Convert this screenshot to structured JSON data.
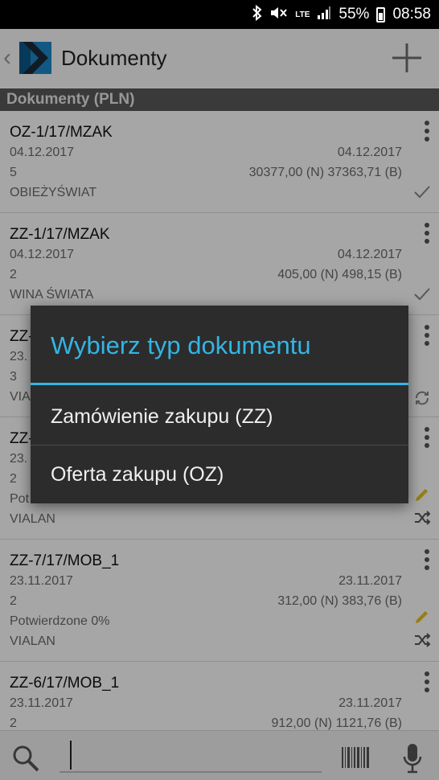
{
  "status_bar": {
    "battery": "55%",
    "time": "08:58",
    "network": "LTE"
  },
  "header": {
    "back": "‹",
    "title": "Dokumenty"
  },
  "section_title": "Dokumenty (PLN)",
  "documents": [
    {
      "number": "OZ-1/17/MZAK",
      "date": "04.12.2017",
      "date2": "04.12.2017",
      "count": "5",
      "amounts": "30377,00 (N) 37363,71 (B)",
      "line3": "OBIEŻYŚWIAT",
      "line4": "",
      "status": "check"
    },
    {
      "number": "ZZ-1/17/MZAK",
      "date": "04.12.2017",
      "date2": "04.12.2017",
      "count": "2",
      "amounts": "405,00 (N) 498,15 (B)",
      "line3": "WINA ŚWIATA",
      "line4": "",
      "status": "check"
    },
    {
      "number": "ZZ-",
      "date": "23.",
      "date2": "",
      "count": "3",
      "amounts": "",
      "line3": "VIAL",
      "line4": "",
      "status": "sync"
    },
    {
      "number": "ZZ-",
      "date": "23.",
      "date2": "",
      "count": "2",
      "amounts": "",
      "line3": "Pot",
      "line4": "VIALAN",
      "status": "edit-shuffle"
    },
    {
      "number": "ZZ-7/17/MOB_1",
      "date": "23.11.2017",
      "date2": "23.11.2017",
      "count": "2",
      "amounts": "312,00 (N) 383,76 (B)",
      "line3": "Potwierdzone 0%",
      "line4": "VIALAN",
      "status": "edit-shuffle"
    },
    {
      "number": "ZZ-6/17/MOB_1",
      "date": "23.11.2017",
      "date2": "23.11.2017",
      "count": "2",
      "amounts": "912,00 (N) 1121,76 (B)",
      "line3": "",
      "line4": "",
      "status": "edit"
    }
  ],
  "search": {
    "value": "",
    "placeholder": ""
  },
  "dialog": {
    "title": "Wybierz typ dokumentu",
    "options": [
      "Zamówienie zakupu (ZZ)",
      "Oferta zakupu (OZ)"
    ]
  },
  "colors": {
    "accent": "#33b5e5",
    "dialog_bg": "#2c2c2c",
    "section_bg": "#595959",
    "edit": "#e8c21f"
  },
  "icons": [
    "bluetooth-icon",
    "mute-icon",
    "signal-icon",
    "battery-icon",
    "back-chevron-icon",
    "app-logo-icon",
    "add-icon",
    "more-vert-icon",
    "check-icon",
    "sync-icon",
    "edit-icon",
    "shuffle-icon",
    "search-icon",
    "barcode-icon",
    "mic-icon"
  ]
}
